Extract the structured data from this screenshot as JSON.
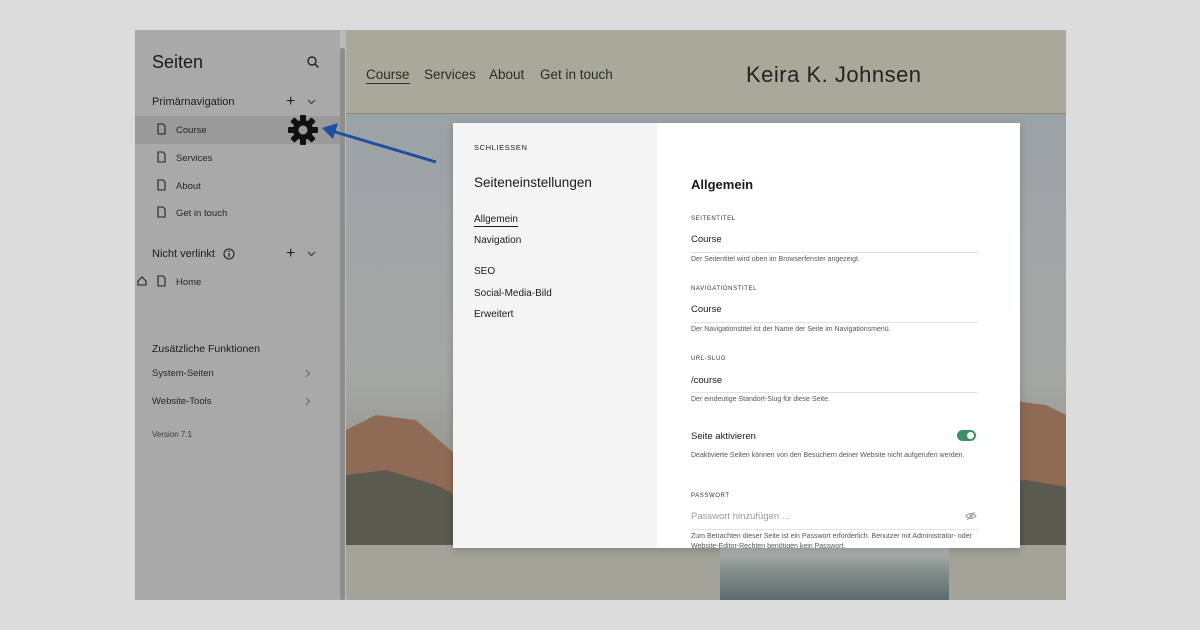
{
  "sidebar": {
    "title": "Seiten",
    "primary_section": "Primärnavigation",
    "primary_items": [
      {
        "label": "Course"
      },
      {
        "label": "Services"
      },
      {
        "label": "About"
      },
      {
        "label": "Get in touch"
      }
    ],
    "unlinked_section": "Nicht verlinkt",
    "unlinked_items": [
      {
        "label": "Home"
      }
    ],
    "extras_title": "Zusätzliche Funktionen",
    "extras": [
      {
        "label": "System-Seiten"
      },
      {
        "label": "Website-Tools"
      }
    ],
    "version": "Version 7.1"
  },
  "site": {
    "nav": [
      "Course",
      "Services",
      "About",
      "Get in touch"
    ],
    "title": "Keira K. Johnsen"
  },
  "dialog": {
    "close": "SCHLIESSEN",
    "title": "Seiteneinstellungen",
    "menu": [
      "Allgemein",
      "Navigation",
      "SEO",
      "Social-Media-Bild",
      "Erweitert"
    ],
    "section_title": "Allgemein",
    "fields": {
      "page_title": {
        "label": "SEITENTITEL",
        "value": "Course",
        "help": "Der Seitentitel wird oben im Browserfenster angezeigt."
      },
      "nav_title": {
        "label": "NAVIGATIONSTITEL",
        "value": "Course",
        "help": "Der Navigationstitel ist der Name der Seite im Navigationsmenü."
      },
      "url_slug": {
        "label": "URL-SLUG",
        "value": "/course",
        "help": "Der eindeutige Standort-Slug für diese Seite."
      },
      "enable_page": {
        "label": "Seite aktivieren",
        "enabled": true,
        "help": "Deaktivierte Seiten können von den Besuchern deiner Website nicht aufgerufen werden."
      },
      "password": {
        "label": "PASSWORT",
        "placeholder": "Passwort hinzufügen ...",
        "help": "Zum Betrachten dieser Seite ist ein Passwort erforderlich. Benutzer mit Administrator- oder Website-Editor-Rechten benötigen kein Passwort."
      }
    }
  },
  "colors": {
    "toggle_on": "#3d8f66",
    "annotation_arrow": "#1f4fa3",
    "sidebar_bg": "#a9a9a9",
    "site_header_bg": "#a9a99b"
  },
  "icons": {
    "search": "search-icon",
    "gear": "gear-icon",
    "page": "page-icon",
    "home": "home-icon",
    "info": "info-icon",
    "eye_off": "eye-off-icon"
  }
}
